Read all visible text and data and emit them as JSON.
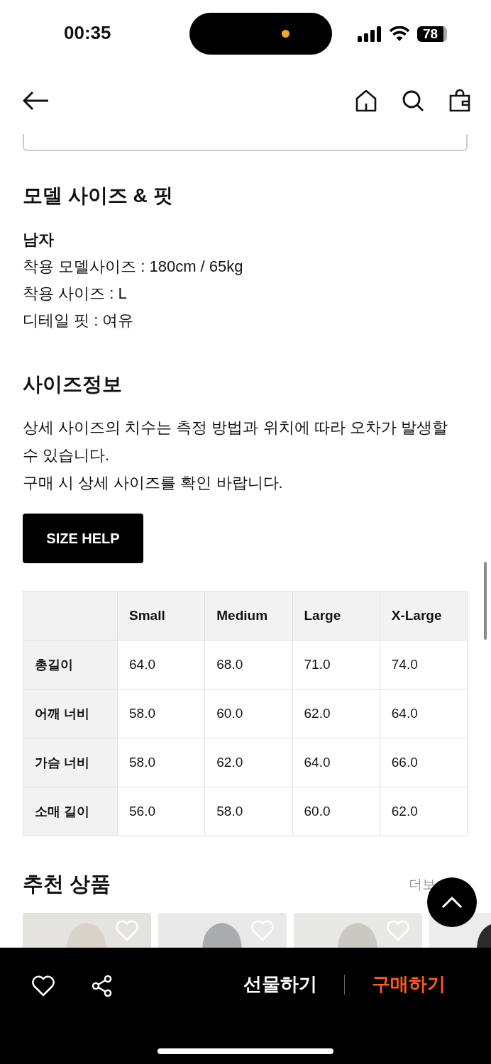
{
  "status_bar": {
    "time": "00:35",
    "battery": "78"
  },
  "model_section": {
    "title": "모델 사이즈 & 핏",
    "gender": "남자",
    "lines": [
      "착용 모델사이즈 : 180cm / 65kg",
      "착용 사이즈 : L",
      "디테일 핏 : 여유"
    ]
  },
  "size_section": {
    "title": "사이즈정보",
    "notes": [
      "상세 사이즈의 치수는 측정 방법과 위치에 따라 오차가 발생할 수 있습니다.",
      "구매 시 상세 사이즈를 확인 바랍니다."
    ],
    "help_button": "SIZE HELP"
  },
  "size_table": {
    "columns": [
      "Small",
      "Medium",
      "Large",
      "X-Large"
    ],
    "rows": [
      {
        "label": "총길이",
        "values": [
          "64.0",
          "68.0",
          "71.0",
          "74.0"
        ]
      },
      {
        "label": "어깨 너비",
        "values": [
          "58.0",
          "60.0",
          "62.0",
          "64.0"
        ]
      },
      {
        "label": "가슴 너비",
        "values": [
          "58.0",
          "62.0",
          "64.0",
          "66.0"
        ]
      },
      {
        "label": "소매 길이",
        "values": [
          "56.0",
          "58.0",
          "60.0",
          "62.0"
        ]
      }
    ]
  },
  "recommended": {
    "title": "추천 상품",
    "more_link": "더보"
  },
  "bottom_bar": {
    "gift_button": "선물하기",
    "buy_button": "구매하기"
  }
}
